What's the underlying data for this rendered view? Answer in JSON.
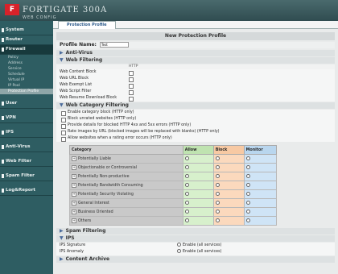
{
  "brand": {
    "logo_mark": "F",
    "name": "FORTIGATE 300A",
    "subtitle": "WEB CONFIG"
  },
  "sidebar": {
    "items": [
      {
        "label": "System"
      },
      {
        "label": "Router"
      },
      {
        "label": "Firewall"
      },
      {
        "label": "User"
      },
      {
        "label": "VPN"
      },
      {
        "label": "IPS"
      },
      {
        "label": "Anti-Virus"
      },
      {
        "label": "Web Filter"
      },
      {
        "label": "Spam Filter"
      },
      {
        "label": "Log&Report"
      }
    ],
    "firewall_subitems": [
      "Policy",
      "Address",
      "Service",
      "Schedule",
      "Virtual IP",
      "IP Pool",
      "Protection Profile"
    ]
  },
  "tabs": [
    "Protection Profile"
  ],
  "form": {
    "title": "New Protection Profile",
    "profile_name_label": "Profile Name:",
    "profile_name_value": "Test"
  },
  "sections": {
    "anti_virus": "Anti-Virus",
    "web_filtering": "Web Filtering",
    "web_category": "Web Category Filtering",
    "spam": "Spam Filtering",
    "ips": "IPS",
    "content_archive": "Content Archive"
  },
  "web_filtering": {
    "column": "HTTP",
    "rows": [
      "Web Content Block",
      "Web URL Block",
      "Web Exempt List",
      "Web Script Filter",
      "Web Resume Download Block"
    ]
  },
  "web_category": {
    "options": [
      "Enable category block (HTTP only)",
      "Block unrated websites (HTTP only)",
      "Provide details for blocked HTTP 4xx and 5xx errors (HTTP only)",
      "Rate images by URL (blocked images will be replaced with blanks) (HTTP only)",
      "Allow websites when a rating error occurs (HTTP only)"
    ],
    "columns": [
      "Category",
      "Allow",
      "Block",
      "Monitor"
    ],
    "categories": [
      "Potentially Liable",
      "Objectionable or Controversial",
      "Potentially Non-productive",
      "Potentially Bandwidth Consuming",
      "Potentially Security Violating",
      "General Interest",
      "Business Oriented",
      "Others"
    ]
  },
  "ips": {
    "rows": [
      {
        "label": "IPS Signature",
        "option": "Enable (all services)"
      },
      {
        "label": "IPS Anomaly",
        "option": "Enable (all services)"
      }
    ]
  }
}
